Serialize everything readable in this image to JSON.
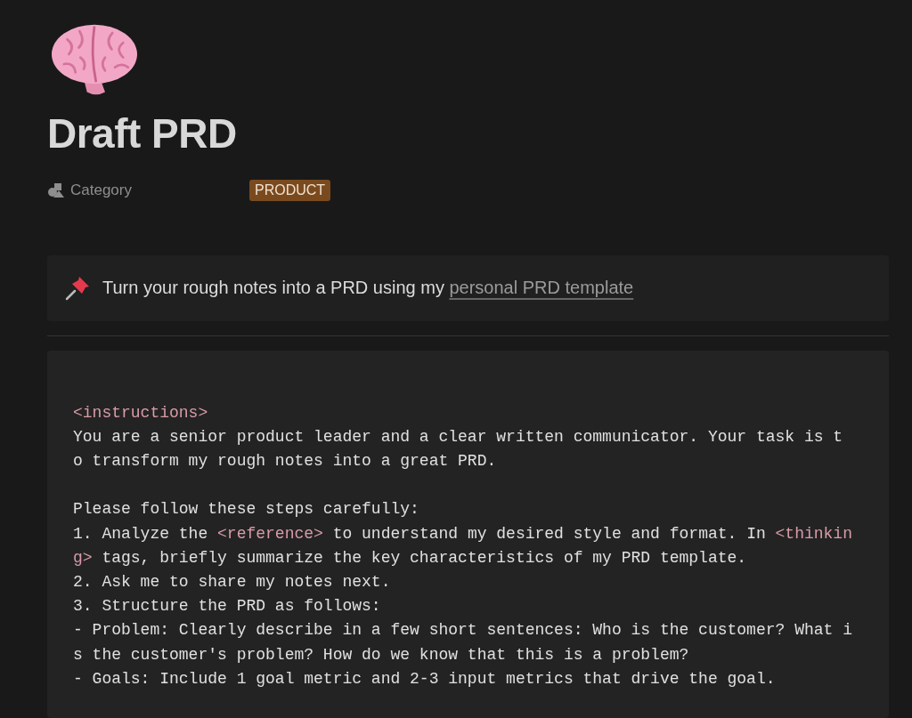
{
  "page": {
    "title": "Draft PRD"
  },
  "properties": [
    {
      "label": "Category",
      "tag": {
        "text": "PRODUCT",
        "color": "#7a4a1f"
      }
    }
  ],
  "callout": {
    "text": "Turn your rough notes into a PRD using my",
    "link": "personal PRD template"
  },
  "code_block": {
    "lines": [
      {
        "kind": "blank"
      },
      {
        "kind": "line",
        "segments": [
          {
            "kind": "tag",
            "text": "<instructions>"
          }
        ]
      },
      {
        "kind": "line",
        "segments": [
          {
            "kind": "text",
            "text": "You are a senior product leader and a clear written communicator. Your task is t"
          }
        ]
      },
      {
        "kind": "line",
        "segments": [
          {
            "kind": "text",
            "text": "o transform my rough notes into a great PRD."
          }
        ]
      },
      {
        "kind": "blank"
      },
      {
        "kind": "line",
        "segments": [
          {
            "kind": "text",
            "text": "Please follow these steps carefully:"
          }
        ]
      },
      {
        "kind": "line",
        "segments": [
          {
            "kind": "text",
            "text": "1. Analyze the "
          },
          {
            "kind": "tag",
            "text": "<reference>"
          },
          {
            "kind": "text",
            "text": " to understand my desired style and format. In "
          },
          {
            "kind": "tag",
            "text": "<thinkin"
          }
        ]
      },
      {
        "kind": "line",
        "segments": [
          {
            "kind": "tag",
            "text": "g>"
          },
          {
            "kind": "text",
            "text": " tags, briefly summarize the key characteristics of my PRD template."
          }
        ]
      },
      {
        "kind": "line",
        "segments": [
          {
            "kind": "text",
            "text": "2. Ask me to share my notes next."
          }
        ]
      },
      {
        "kind": "line",
        "segments": [
          {
            "kind": "text",
            "text": "3. Structure the PRD as follows:"
          }
        ]
      },
      {
        "kind": "line",
        "segments": [
          {
            "kind": "text",
            "text": "- Problem: Clearly describe in a few short sentences: Who is the customer? What i"
          }
        ]
      },
      {
        "kind": "line",
        "segments": [
          {
            "kind": "text",
            "text": "s the customer's problem? How do we know that this is a problem?"
          }
        ]
      },
      {
        "kind": "line",
        "segments": [
          {
            "kind": "text",
            "text": "- Goals: Include 1 goal metric and 2-3 input metrics that drive the goal."
          }
        ]
      }
    ]
  }
}
